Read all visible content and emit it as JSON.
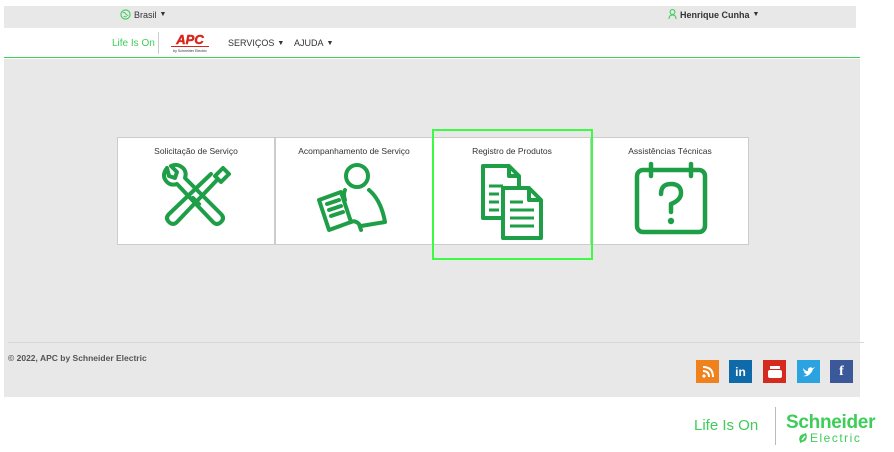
{
  "topbar": {
    "region_label": "Brasil",
    "user_name": "Henrique Cunha"
  },
  "navbar": {
    "life_is_on": "Life Is On",
    "apc_logo_text": "APC",
    "apc_logo_sub": "by Schneider Electric",
    "menu_services": "SERVIÇOS",
    "menu_help": "AJUDA"
  },
  "tiles": [
    {
      "label": "Solicitação de Serviço",
      "icon": "tools-icon"
    },
    {
      "label": "Acompanhamento de Serviço",
      "icon": "person-clipboard-icon"
    },
    {
      "label": "Registro de Produtos",
      "icon": "documents-icon"
    },
    {
      "label": "Assistências Técnicas",
      "icon": "calendar-question-icon"
    }
  ],
  "footer": {
    "copyright": "© 2022, APC by Schneider Electric",
    "social": [
      "rss-icon",
      "linkedin-icon",
      "youtube-icon",
      "twitter-icon",
      "facebook-icon"
    ]
  },
  "bottom_logo": {
    "life_is_on": "Life Is On",
    "brand": "Schneider",
    "brand_sub": "Electric"
  },
  "colors": {
    "brand_green": "#3dcd58",
    "icon_green": "#1e9e47",
    "highlight": "#3dfb45"
  }
}
